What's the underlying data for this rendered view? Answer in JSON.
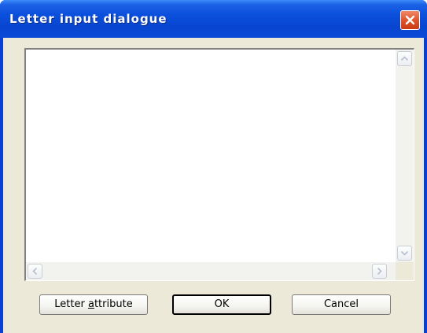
{
  "window": {
    "title": "Letter input dialogue",
    "close_icon": "close-x-icon"
  },
  "editor": {
    "value": "",
    "scroll_up_icon": "arrow-up-icon",
    "scroll_down_icon": "arrow-down-icon",
    "scroll_left_icon": "arrow-left-icon",
    "scroll_right_icon": "arrow-right-icon"
  },
  "buttons": {
    "letter_attribute_pre": "Letter ",
    "letter_attribute_accel": "a",
    "letter_attribute_post": "ttribute",
    "ok": "OK",
    "cancel": "Cancel"
  },
  "colors": {
    "titlebar": "#0a49d6",
    "close_button": "#e0552c",
    "dialog_face": "#ece9d8"
  }
}
